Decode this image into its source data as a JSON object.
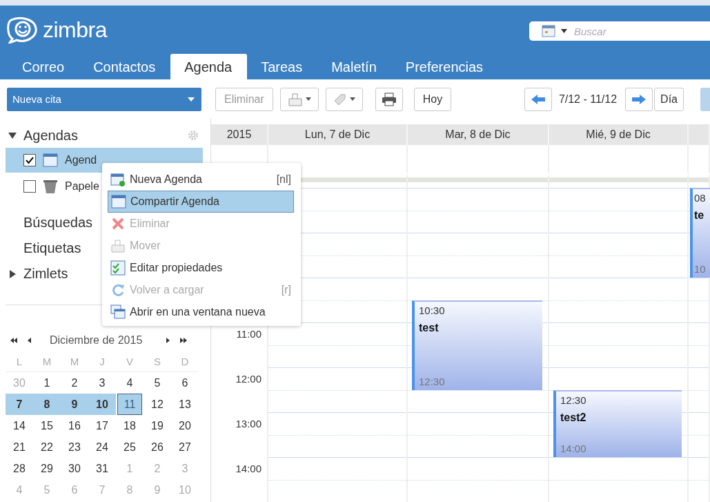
{
  "logo": {
    "text": "zimbra"
  },
  "search": {
    "placeholder": "Buscar"
  },
  "tabs": [
    {
      "label": "Correo",
      "selected": false
    },
    {
      "label": "Contactos",
      "selected": false
    },
    {
      "label": "Agenda",
      "selected": true
    },
    {
      "label": "Tareas",
      "selected": false
    },
    {
      "label": "Maletín",
      "selected": false
    },
    {
      "label": "Preferencias",
      "selected": false
    }
  ],
  "toolbar": {
    "new_item": "Nueva cita",
    "delete": {
      "label": "Eliminar",
      "disabled": true
    },
    "today": "Hoy",
    "range": "7/12 - 11/12",
    "view": "Día"
  },
  "sidebar": {
    "header": {
      "label": "Agendas",
      "expanded": true
    },
    "calendars": [
      {
        "label": "Agend",
        "kind": "calendar",
        "checked": true,
        "selected": true
      },
      {
        "label": "Papele",
        "kind": "trash",
        "checked": false,
        "selected": false
      }
    ],
    "sections": [
      {
        "label": "Búsquedas",
        "kind": "plain"
      },
      {
        "label": "Etiquetas",
        "kind": "plain"
      },
      {
        "label": "Zimlets",
        "kind": "tree",
        "expanded": false
      }
    ]
  },
  "mini_calendar": {
    "title": "Diciembre de 2015",
    "weekdays": [
      "L",
      "M",
      "M",
      "J",
      "V",
      "S",
      "D"
    ],
    "weeks": [
      [
        {
          "label": "30",
          "other_month": true,
          "selected": false,
          "bold": false,
          "today": false
        },
        {
          "label": "1",
          "other_month": false,
          "selected": false,
          "bold": false,
          "today": false
        },
        {
          "label": "2",
          "other_month": false,
          "selected": false,
          "bold": false,
          "today": false
        },
        {
          "label": "3",
          "other_month": false,
          "selected": false,
          "bold": false,
          "today": false
        },
        {
          "label": "4",
          "other_month": false,
          "selected": false,
          "bold": false,
          "today": false
        },
        {
          "label": "5",
          "other_month": false,
          "selected": false,
          "bold": false,
          "today": false
        },
        {
          "label": "6",
          "other_month": false,
          "selected": false,
          "bold": false,
          "today": false
        }
      ],
      [
        {
          "label": "7",
          "other_month": false,
          "selected": true,
          "bold": true,
          "today": false
        },
        {
          "label": "8",
          "other_month": false,
          "selected": true,
          "bold": true,
          "today": false
        },
        {
          "label": "9",
          "other_month": false,
          "selected": true,
          "bold": true,
          "today": false
        },
        {
          "label": "10",
          "other_month": false,
          "selected": true,
          "bold": true,
          "today": false
        },
        {
          "label": "11",
          "other_month": false,
          "selected": true,
          "bold": false,
          "today": true
        },
        {
          "label": "12",
          "other_month": false,
          "selected": false,
          "bold": false,
          "today": false
        },
        {
          "label": "13",
          "other_month": false,
          "selected": false,
          "bold": false,
          "today": false
        }
      ],
      [
        {
          "label": "14",
          "other_month": false,
          "selected": false,
          "bold": false,
          "today": false
        },
        {
          "label": "15",
          "other_month": false,
          "selected": false,
          "bold": false,
          "today": false
        },
        {
          "label": "16",
          "other_month": false,
          "selected": false,
          "bold": false,
          "today": false
        },
        {
          "label": "17",
          "other_month": false,
          "selected": false,
          "bold": false,
          "today": false
        },
        {
          "label": "18",
          "other_month": false,
          "selected": false,
          "bold": false,
          "today": false
        },
        {
          "label": "19",
          "other_month": false,
          "selected": false,
          "bold": false,
          "today": false
        },
        {
          "label": "20",
          "other_month": false,
          "selected": false,
          "bold": false,
          "today": false
        }
      ],
      [
        {
          "label": "21",
          "other_month": false,
          "selected": false,
          "bold": false,
          "today": false
        },
        {
          "label": "22",
          "other_month": false,
          "selected": false,
          "bold": false,
          "today": false
        },
        {
          "label": "23",
          "other_month": false,
          "selected": false,
          "bold": false,
          "today": false
        },
        {
          "label": "24",
          "other_month": false,
          "selected": false,
          "bold": false,
          "today": false
        },
        {
          "label": "25",
          "other_month": false,
          "selected": false,
          "bold": false,
          "today": false
        },
        {
          "label": "26",
          "other_month": false,
          "selected": false,
          "bold": false,
          "today": false
        },
        {
          "label": "27",
          "other_month": false,
          "selected": false,
          "bold": false,
          "today": false
        }
      ],
      [
        {
          "label": "28",
          "other_month": false,
          "selected": false,
          "bold": false,
          "today": false
        },
        {
          "label": "29",
          "other_month": false,
          "selected": false,
          "bold": false,
          "today": false
        },
        {
          "label": "30",
          "other_month": false,
          "selected": false,
          "bold": false,
          "today": false
        },
        {
          "label": "31",
          "other_month": false,
          "selected": false,
          "bold": false,
          "today": false
        },
        {
          "label": "1",
          "other_month": true,
          "selected": false,
          "bold": false,
          "today": false
        },
        {
          "label": "2",
          "other_month": true,
          "selected": false,
          "bold": false,
          "today": false
        },
        {
          "label": "3",
          "other_month": true,
          "selected": false,
          "bold": false,
          "today": false
        }
      ],
      [
        {
          "label": "4",
          "other_month": true,
          "selected": false,
          "bold": false,
          "today": false
        },
        {
          "label": "5",
          "other_month": true,
          "selected": false,
          "bold": false,
          "today": false
        },
        {
          "label": "6",
          "other_month": true,
          "selected": false,
          "bold": false,
          "today": false
        },
        {
          "label": "7",
          "other_month": true,
          "selected": false,
          "bold": false,
          "today": false
        },
        {
          "label": "8",
          "other_month": true,
          "selected": false,
          "bold": false,
          "today": false
        },
        {
          "label": "9",
          "other_month": true,
          "selected": false,
          "bold": false,
          "today": false
        },
        {
          "label": "10",
          "other_month": true,
          "selected": false,
          "bold": false,
          "today": false
        }
      ]
    ]
  },
  "calendar": {
    "year": "2015",
    "hour_labels": [
      "11:00",
      "12:00",
      "13:00",
      "14:00"
    ],
    "days": [
      {
        "label": "Lun, 7 de Dic"
      },
      {
        "label": "Mar, 8 de Dic",
        "events": [
          {
            "start": "10:30",
            "title": "test",
            "end": "12:30"
          }
        ]
      },
      {
        "label": "Mié, 9 de Dic",
        "events": [
          {
            "start": "12:30",
            "title": "test2",
            "end": "14:00"
          }
        ]
      },
      {
        "events": [
          {
            "start": "08",
            "title": "te",
            "end": "10"
          }
        ]
      }
    ]
  },
  "context_menu": {
    "items": [
      {
        "label": "Nueva Agenda",
        "kind": "new",
        "shortcut": "[nl]",
        "disabled": false,
        "selected": false
      },
      {
        "label": "Compartir Agenda",
        "kind": "share",
        "disabled": false,
        "selected": true
      },
      {
        "label": "Eliminar",
        "kind": "delete",
        "disabled": true,
        "selected": false
      },
      {
        "label": "Mover",
        "kind": "move",
        "disabled": true,
        "selected": false
      },
      {
        "label": "Editar propiedades",
        "kind": "edit",
        "disabled": false,
        "selected": false
      },
      {
        "label": "Volver a cargar",
        "kind": "reload",
        "shortcut": "[r]",
        "disabled": true,
        "selected": false
      },
      {
        "label": "Abrir en una ventana nueva",
        "kind": "window",
        "disabled": false,
        "selected": false
      }
    ]
  }
}
